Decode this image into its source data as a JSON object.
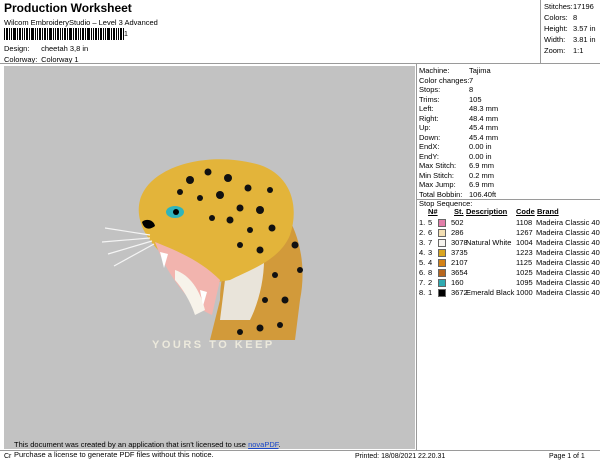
{
  "header": {
    "title": "Production Worksheet",
    "subtitle": "Wilcom EmbroideryStudio – Level 3 Advanced",
    "barcode_suffix": "1"
  },
  "meta": {
    "design_label": "Design:",
    "design_value": "cheetah 3,8 in",
    "colorway_label": "Colorway:",
    "colorway_value": "Colorway 1"
  },
  "stats": [
    {
      "label": "Stitches:",
      "value": "17196"
    },
    {
      "label": "Colors:",
      "value": "8"
    },
    {
      "label": "Height:",
      "value": "3.57 in"
    },
    {
      "label": "Width:",
      "value": "3.81 in"
    },
    {
      "label": "Zoom:",
      "value": "1:1"
    }
  ],
  "machine_info": [
    {
      "label": "Machine:",
      "value": "Tajima"
    },
    {
      "label": "Color changes:",
      "value": "7"
    },
    {
      "label": "Stops:",
      "value": "8"
    },
    {
      "label": "Trims:",
      "value": "105"
    },
    {
      "label": "Left:",
      "value": "48.3 mm"
    },
    {
      "label": "Right:",
      "value": "48.4 mm"
    },
    {
      "label": "Up:",
      "value": "45.4 mm"
    },
    {
      "label": "Down:",
      "value": "45.4 mm"
    },
    {
      "label": "EndX:",
      "value": "0.00 in"
    },
    {
      "label": "EndY:",
      "value": "0.00 in"
    },
    {
      "label": "Max Stitch:",
      "value": "6.9 mm"
    },
    {
      "label": "Min Stitch:",
      "value": "0.2 mm"
    },
    {
      "label": "Max Jump:",
      "value": "6.9 mm"
    },
    {
      "label": "Total Bobbin:",
      "value": "106.40ft"
    }
  ],
  "stop_sequence": {
    "title": "Stop Sequence:",
    "headers": {
      "n": "N#",
      "st": "St.",
      "description": "Description",
      "code": "Code",
      "brand": "Brand"
    },
    "rows": [
      {
        "idx": "1.",
        "n": "5",
        "color": "#e27faa",
        "st": "502",
        "description": "",
        "code": "1108",
        "brand": "Madeira Classic 40"
      },
      {
        "idx": "2.",
        "n": "6",
        "color": "#f3dfb3",
        "st": "286",
        "description": "",
        "code": "1267",
        "brand": "Madeira Classic 40"
      },
      {
        "idx": "3.",
        "n": "7",
        "color": "#f6f4ef",
        "st": "3078",
        "description": "Natural White",
        "code": "1004",
        "brand": "Madeira Classic 40"
      },
      {
        "idx": "4.",
        "n": "3",
        "color": "#d9a521",
        "st": "3735",
        "description": "",
        "code": "1223",
        "brand": "Madeira Classic 40"
      },
      {
        "idx": "5.",
        "n": "4",
        "color": "#d48216",
        "st": "2107",
        "description": "",
        "code": "1125",
        "brand": "Madeira Classic 40"
      },
      {
        "idx": "6.",
        "n": "8",
        "color": "#b7661e",
        "st": "3654",
        "description": "",
        "code": "1025",
        "brand": "Madeira Classic 40"
      },
      {
        "idx": "7.",
        "n": "2",
        "color": "#2faab1",
        "st": "160",
        "description": "",
        "code": "1095",
        "brand": "Madeira Classic 40"
      },
      {
        "idx": "8.",
        "n": "1",
        "color": "#000000",
        "st": "3672",
        "description": "Emerald Black",
        "code": "1000",
        "brand": "Madeira Classic 40"
      }
    ]
  },
  "design": {
    "slogan": "YOURS TO KEEP"
  },
  "notice": {
    "line1_pre": "This document was created by an application that isn't licensed to use ",
    "link": "novaPDF",
    "line1_post": ".",
    "line2": "Purchase a license to generate PDF files without this notice."
  },
  "footer": {
    "left": "Cr",
    "printed": "Printed: 18/08/2021 22.20.31",
    "page": "Page 1 of 1"
  }
}
